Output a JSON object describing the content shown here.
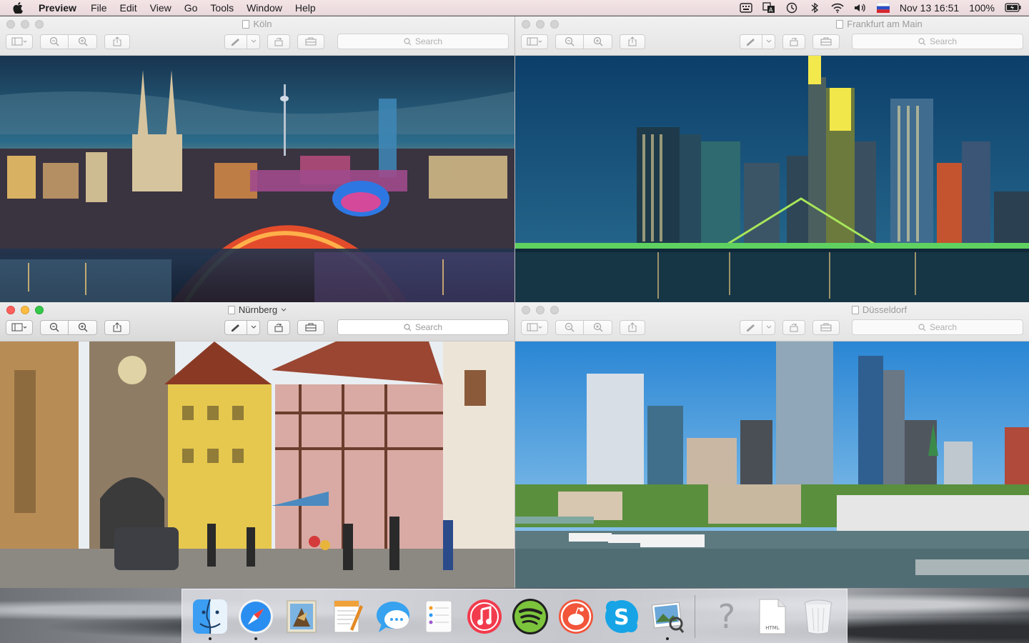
{
  "menubar": {
    "app_name": "Preview",
    "menus": [
      "File",
      "Edit",
      "View",
      "Go",
      "Tools",
      "Window",
      "Help"
    ],
    "status": {
      "datetime": "Nov 13  16:51",
      "battery": "100%"
    }
  },
  "windows": {
    "koln": {
      "title": "Köln",
      "search_placeholder": "Search"
    },
    "frankfurt": {
      "title": "Frankfurt am Main",
      "search_placeholder": "Search"
    },
    "nurnberg": {
      "title": "Nürnberg",
      "search_placeholder": "Search"
    },
    "dusseldorf": {
      "title": "Düsseldorf",
      "search_placeholder": "Search"
    }
  },
  "dock": {
    "file_label": "HTML",
    "question_mark": "?",
    "apps": [
      "finder-icon",
      "safari-icon",
      "mail-icon",
      "pages-icon",
      "messages-icon",
      "reminders-icon",
      "itunes-icon",
      "spotify-icon",
      "reddit-app-icon",
      "skype-icon",
      "preview-icon"
    ]
  },
  "colors": {
    "accent_red": "#fc605c",
    "accent_yellow": "#fdbc40",
    "accent_green": "#34c84a"
  }
}
